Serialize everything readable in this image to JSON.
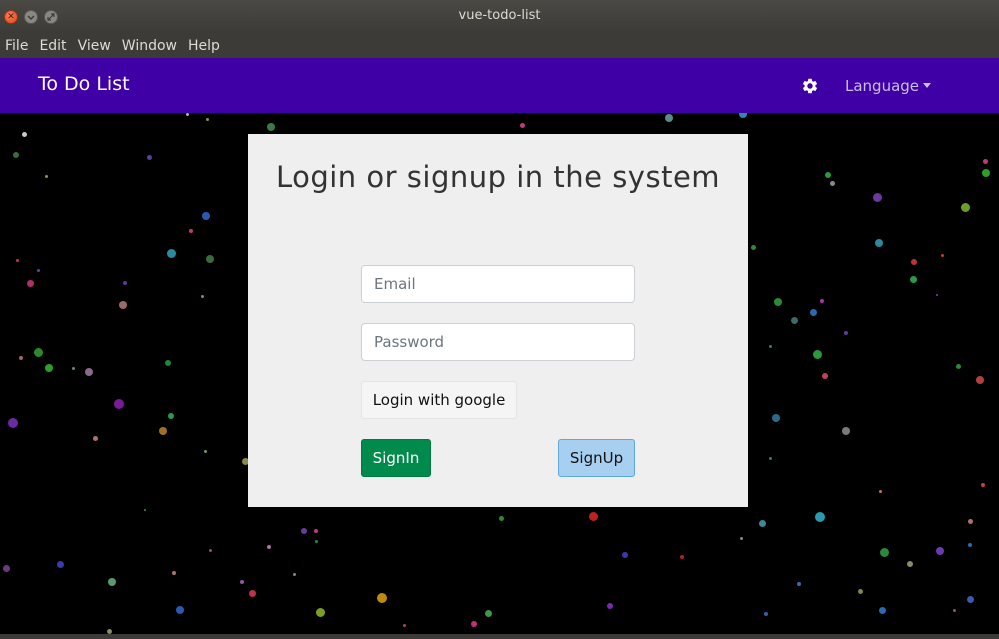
{
  "window": {
    "title": "vue-todo-list",
    "buttons": {
      "close_icon": "close-icon",
      "minimize_icon": "minimize-icon",
      "maximize_icon": "maximize-icon"
    }
  },
  "menubar": {
    "items": [
      {
        "label": "File"
      },
      {
        "label": "Edit"
      },
      {
        "label": "View"
      },
      {
        "label": "Window"
      },
      {
        "label": "Help"
      }
    ]
  },
  "navbar": {
    "brand": "To Do List",
    "settings_icon": "gear-icon",
    "language_label": "Language",
    "background_color": "#3f00a6"
  },
  "card": {
    "title": "Login or signup in the system",
    "email": {
      "value": "",
      "placeholder": "Email"
    },
    "password": {
      "value": "",
      "placeholder": "Password"
    },
    "google_button": "Login with google",
    "signin_button": "SignIn",
    "signup_button": "SignUp"
  },
  "colors": {
    "signin": "#008a4c",
    "signup": "#a6cff0",
    "card_background": "#efefef",
    "page_background": "#000000"
  }
}
